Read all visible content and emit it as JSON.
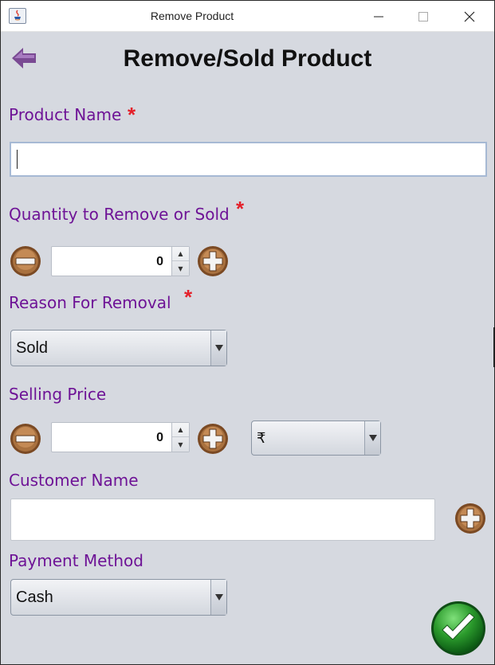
{
  "window": {
    "title": "Remove Product"
  },
  "header": {
    "title": "Remove/Sold Product",
    "back_icon": "back-arrow-icon"
  },
  "required_mark": "*",
  "product_name": {
    "label": "Product Name",
    "value": ""
  },
  "quantity": {
    "label": "Quantity to Remove or Sold",
    "value": "0"
  },
  "reason": {
    "label": "Reason For Removal",
    "selected": "Sold"
  },
  "selling_price": {
    "label": "Selling Price",
    "value": "0",
    "currency": "₹"
  },
  "customer": {
    "label": "Customer Name",
    "value": ""
  },
  "payment": {
    "label": "Payment Method",
    "selected": "Cash"
  },
  "colors": {
    "label": "#6e1396",
    "required": "#e4202a",
    "accent_button": "#8b5a2b",
    "confirm": "#1f8a2c"
  }
}
